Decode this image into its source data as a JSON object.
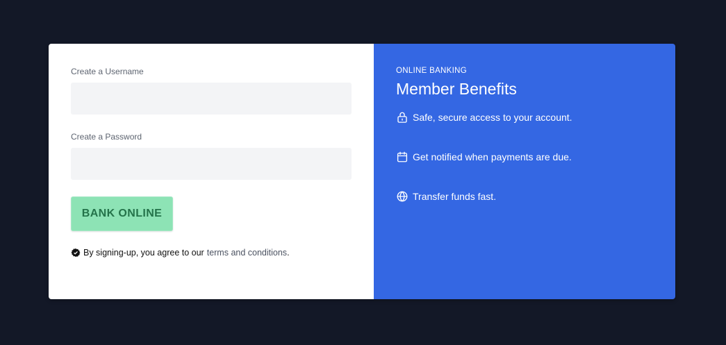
{
  "form": {
    "username_label": "Create a Username",
    "username_value": "",
    "password_label": "Create a Password",
    "password_value": "",
    "submit_label": "BANK ONLINE",
    "terms_prefix": "By signing-up, you agree to our",
    "terms_link": "terms and conditions",
    "terms_suffix": "."
  },
  "benefits_panel": {
    "eyebrow": "ONLINE BANKING",
    "heading": "Member Benefits",
    "items": [
      {
        "icon": "lock-icon",
        "label": "Safe, secure access to your account."
      },
      {
        "icon": "calendar-icon",
        "label": "Get notified when payments are due."
      },
      {
        "icon": "globe-icon",
        "label": "Transfer funds fast."
      }
    ]
  },
  "colors": {
    "page_background": "#131827",
    "panel_accent": "#3467e3",
    "button_background": "#8de3b5",
    "button_text": "#24734a",
    "input_background": "#f3f4f6"
  }
}
